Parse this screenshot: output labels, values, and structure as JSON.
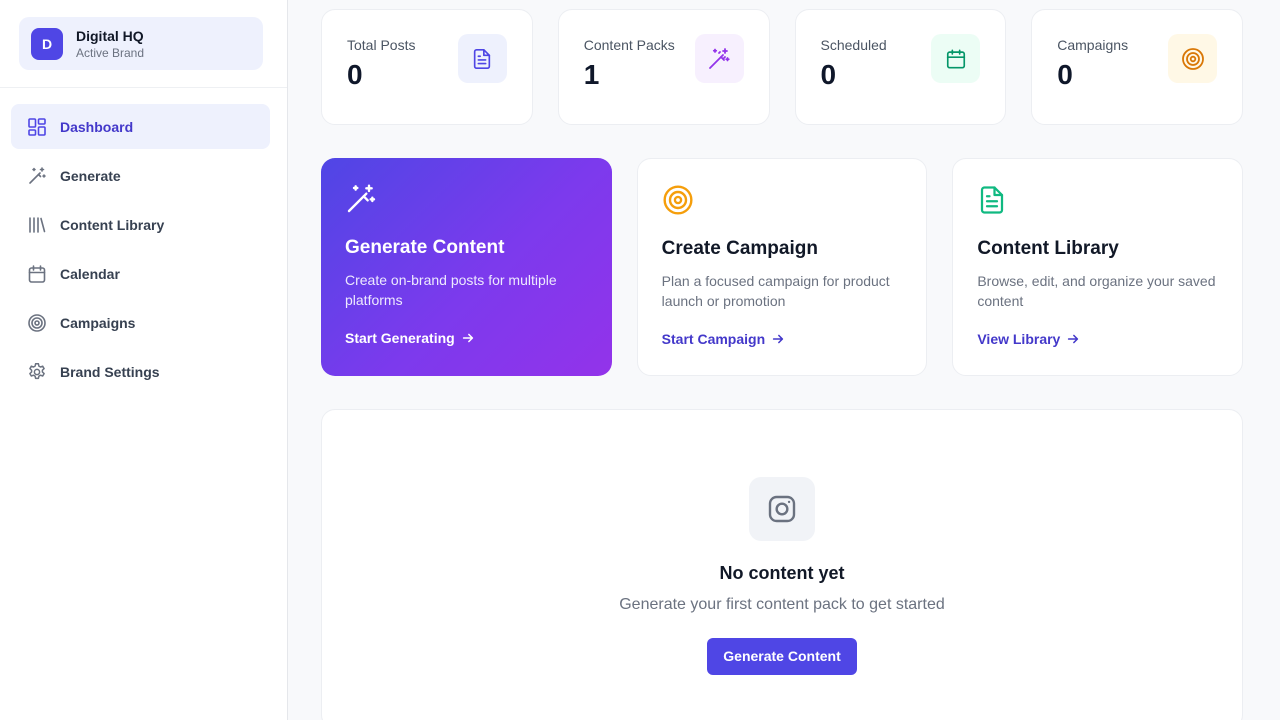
{
  "brand": {
    "initial": "D",
    "name": "Digital HQ",
    "status": "Active Brand"
  },
  "nav": [
    {
      "label": "Dashboard",
      "icon": "dashboard-icon",
      "active": true
    },
    {
      "label": "Generate",
      "icon": "magic-wand-icon"
    },
    {
      "label": "Content Library",
      "icon": "library-icon"
    },
    {
      "label": "Calendar",
      "icon": "calendar-icon"
    },
    {
      "label": "Campaigns",
      "icon": "target-icon"
    },
    {
      "label": "Brand Settings",
      "icon": "gear-icon"
    }
  ],
  "stats": [
    {
      "label": "Total Posts",
      "value": "0",
      "icon": "document-icon",
      "color": "#4f46e5",
      "bg": "#eef1fd"
    },
    {
      "label": "Content Packs",
      "value": "1",
      "icon": "magic-wand-icon",
      "color": "#9333ea",
      "bg": "#f7f0fe"
    },
    {
      "label": "Scheduled",
      "value": "0",
      "icon": "calendar-icon",
      "color": "#059669",
      "bg": "#ecfdf5"
    },
    {
      "label": "Campaigns",
      "value": "0",
      "icon": "target-icon",
      "color": "#d97706",
      "bg": "#fff8e6"
    }
  ],
  "actions": [
    {
      "title": "Generate Content",
      "desc": "Create on-brand posts for multiple platforms",
      "link": "Start Generating",
      "icon": "magic-wand-icon"
    },
    {
      "title": "Create Campaign",
      "desc": "Plan a focused campaign for product launch or promotion",
      "link": "Start Campaign",
      "icon": "target-icon",
      "color": "#f59e0b"
    },
    {
      "title": "Content Library",
      "desc": "Browse, edit, and organize your saved content",
      "link": "View Library",
      "icon": "document-icon",
      "color": "#10b981"
    }
  ],
  "empty": {
    "title": "No content yet",
    "subtitle": "Generate your first content pack to get started",
    "button": "Generate Content",
    "icon": "instagram-icon"
  },
  "colors": {
    "accent": "#4f46e5",
    "accent_dark": "#4338ca"
  }
}
